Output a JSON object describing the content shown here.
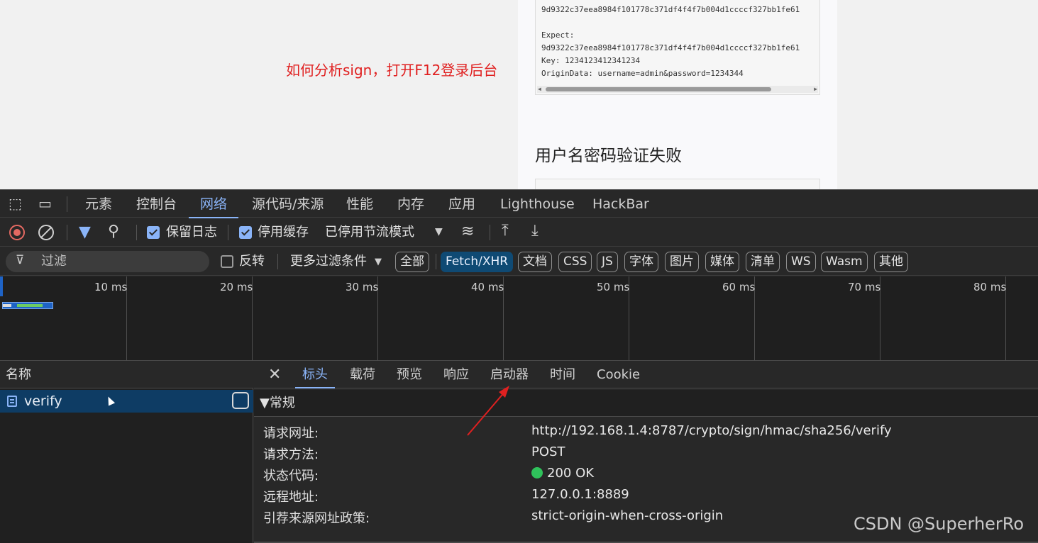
{
  "page": {
    "annotation": "如何分析sign，打开F12登录后台",
    "code_lines": [
      "9d9322c37eea8984f101778c371df4f4f7b004d1ccccf327bb1fe61",
      "",
      " Expect:",
      "9d9322c37eea8984f101778c371df4f4f7b004d1ccccf327bb1fe61",
      " Key: 1234123412341234",
      " OriginData: username=admin&password=1234344"
    ],
    "heading": "用户名密码验证失败"
  },
  "devtools": {
    "main_tabs": [
      "元素",
      "控制台",
      "网络",
      "源代码/来源",
      "性能",
      "内存",
      "应用",
      "Lighthouse",
      "HackBar"
    ],
    "active_tab": "网络",
    "toolbar": {
      "preserve_log": "保留日志",
      "disable_cache": "停用缓存",
      "throttling": "已停用节流模式"
    },
    "filter": {
      "placeholder": "过滤",
      "invert": "反转",
      "more_filters": "更多过滤条件",
      "types": [
        "全部",
        "Fetch/XHR",
        "文档",
        "CSS",
        "JS",
        "字体",
        "图片",
        "媒体",
        "清单",
        "WS",
        "Wasm",
        "其他"
      ],
      "active_type": "Fetch/XHR"
    },
    "timeline_ticks": [
      "10 ms",
      "20 ms",
      "30 ms",
      "40 ms",
      "50 ms",
      "60 ms",
      "70 ms",
      "80 ms"
    ],
    "name_header": "名称",
    "request": {
      "name": "verify"
    },
    "detail_tabs": [
      "标头",
      "载荷",
      "预览",
      "响应",
      "启动器",
      "时间",
      "Cookie"
    ],
    "active_detail_tab": "标头",
    "general_section": "▼常规",
    "general": [
      {
        "key": "请求网址:",
        "value": "http://192.168.1.4:8787/crypto/sign/hmac/sha256/verify"
      },
      {
        "key": "请求方法:",
        "value": "POST"
      },
      {
        "key": "状态代码:",
        "value": "200 OK"
      },
      {
        "key": "远程地址:",
        "value": "127.0.0.1:8889"
      },
      {
        "key": "引荐来源网址政策:",
        "value": "strict-origin-when-cross-origin"
      }
    ]
  },
  "watermark": "CSDN @SuperherRo",
  "colors": {
    "accent": "#8ab4f8",
    "annotation_red": "#e02020",
    "status_green": "#2fc25b",
    "selected_row": "#0e3c64"
  }
}
